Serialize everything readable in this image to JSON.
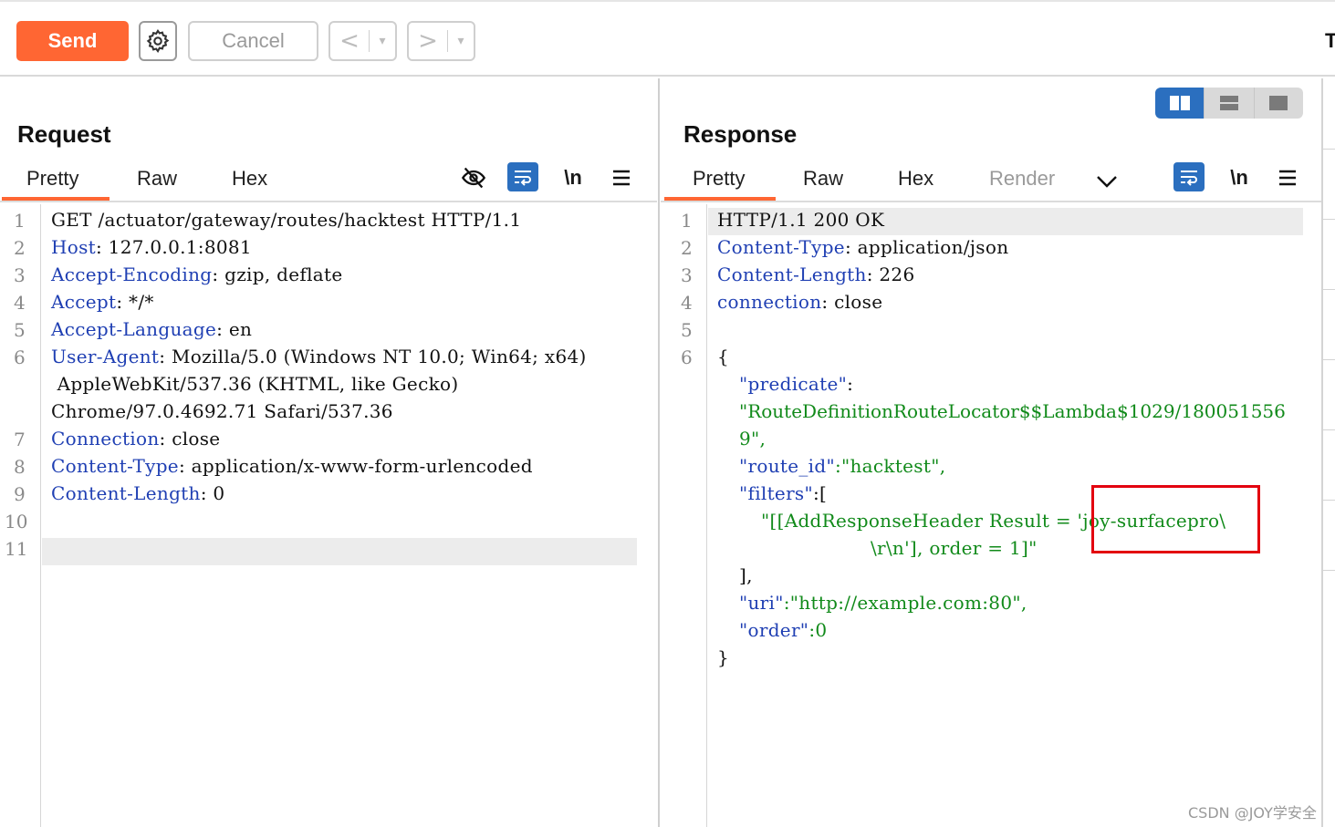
{
  "toolbar": {
    "send_label": "Send",
    "cancel_label": "Cancel",
    "back_arrow": "<",
    "forward_arrow": ">",
    "dropdown_glyph": "▾",
    "edge_text": "T"
  },
  "request": {
    "title": "Request",
    "tabs": [
      "Pretty",
      "Raw",
      "Hex"
    ],
    "active_tab": "Pretty",
    "line_numbers": [
      "1",
      "2",
      "3",
      "4",
      "5",
      "6",
      "7",
      "8",
      "9",
      "10",
      "11"
    ],
    "lines": [
      {
        "plain": "GET /actuator/gateway/routes/hacktest HTTP/1.1"
      },
      {
        "key": "Host",
        "value": ": 127.0.0.1:8081"
      },
      {
        "key": "Accept-Encoding",
        "value": ": gzip, deflate"
      },
      {
        "key": "Accept",
        "value": ": */*"
      },
      {
        "key": "Accept-Language",
        "value": ": en"
      },
      {
        "key": "User-Agent",
        "value": ": Mozilla/5.0 (Windows NT 10.0; Win64; x64)"
      },
      {
        "plain": " AppleWebKit/537.36 (KHTML, like Gecko)"
      },
      {
        "plain": "Chrome/97.0.4692.71 Safari/537.36"
      },
      {
        "key": "Connection",
        "value": ": close"
      },
      {
        "key": "Content-Type",
        "value": ": application/x-www-form-urlencoded"
      },
      {
        "key": "Content-Length",
        "value": ": 0"
      }
    ]
  },
  "response": {
    "title": "Response",
    "tabs": [
      "Pretty",
      "Raw",
      "Hex",
      "Render"
    ],
    "active_tab": "Pretty",
    "line_numbers": [
      "1",
      "2",
      "3",
      "4",
      "5",
      "6"
    ],
    "status_line": "HTTP/1.1 200 OK",
    "headers": [
      {
        "key": "Content-Type",
        "value": ": application/json"
      },
      {
        "key": "Content-Length",
        "value": ": 226"
      },
      {
        "key": "connection",
        "value": ": close"
      }
    ],
    "json": {
      "open_brace": "{",
      "predicate_key": "\"predicate\"",
      "predicate_colon": ":",
      "predicate_value_1": "\"RouteDefinitionRouteLocator$$Lambda$1029/180051556",
      "predicate_value_2": "9\",",
      "route_id_key": "\"route_id\"",
      "route_id_value": ":\"hacktest\",",
      "filters_key": "\"filters\"",
      "filters_open": ":[",
      "filter_item_1": "\"[[AddResponseHeader Result = 'joy-surfacepro\\",
      "filter_item_2": "\\r\\n'], order = 1]\"",
      "filters_close": "],",
      "uri_key": "\"uri\"",
      "uri_value": ":\"http://example.com:80\",",
      "order_key": "\"order\"",
      "order_value": ":0",
      "close_brace": "}"
    }
  },
  "icons": {
    "gear": "gear-icon",
    "hide": "eye-slash-icon",
    "wrap": "text-wrap-icon",
    "newline": "\\n",
    "menu": "hamburger-menu-icon",
    "chevron": "chevron-down-icon"
  },
  "watermark": "CSDN @JOY学安全",
  "colors": {
    "accent": "#ff6633",
    "selected_blue": "#2b6fbf",
    "header_key": "#1f3fb3",
    "json_value": "#118a1a",
    "highlight_box": "#e3000f"
  }
}
